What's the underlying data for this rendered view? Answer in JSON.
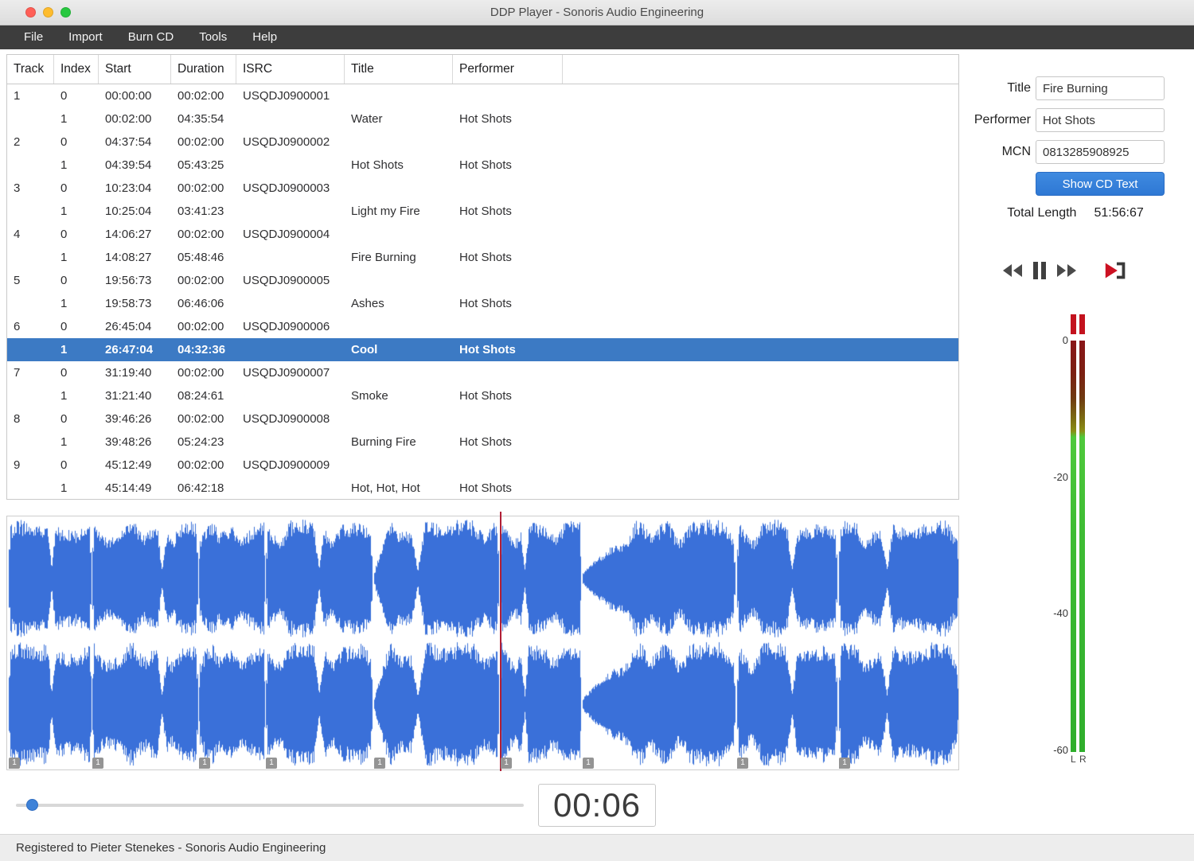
{
  "window": {
    "title": "DDP Player - Sonoris Audio Engineering"
  },
  "menu": {
    "items": [
      "File",
      "Import",
      "Burn CD",
      "Tools",
      "Help"
    ]
  },
  "table": {
    "columns": [
      "Track",
      "Index",
      "Start",
      "Duration",
      "ISRC",
      "Title",
      "Performer"
    ],
    "rows": [
      {
        "track": "1",
        "index": "0",
        "start": "00:00:00",
        "duration": "00:02:00",
        "isrc": "USQDJ0900001",
        "title": "",
        "performer": "",
        "selected": false
      },
      {
        "track": "",
        "index": "1",
        "start": "00:02:00",
        "duration": "04:35:54",
        "isrc": "",
        "title": "Water",
        "performer": "Hot Shots",
        "selected": false
      },
      {
        "track": "2",
        "index": "0",
        "start": "04:37:54",
        "duration": "00:02:00",
        "isrc": "USQDJ0900002",
        "title": "",
        "performer": "",
        "selected": false
      },
      {
        "track": "",
        "index": "1",
        "start": "04:39:54",
        "duration": "05:43:25",
        "isrc": "",
        "title": "Hot Shots",
        "performer": "Hot Shots",
        "selected": false
      },
      {
        "track": "3",
        "index": "0",
        "start": "10:23:04",
        "duration": "00:02:00",
        "isrc": "USQDJ0900003",
        "title": "",
        "performer": "",
        "selected": false
      },
      {
        "track": "",
        "index": "1",
        "start": "10:25:04",
        "duration": "03:41:23",
        "isrc": "",
        "title": "Light my Fire",
        "performer": "Hot Shots",
        "selected": false
      },
      {
        "track": "4",
        "index": "0",
        "start": "14:06:27",
        "duration": "00:02:00",
        "isrc": "USQDJ0900004",
        "title": "",
        "performer": "",
        "selected": false
      },
      {
        "track": "",
        "index": "1",
        "start": "14:08:27",
        "duration": "05:48:46",
        "isrc": "",
        "title": "Fire Burning",
        "performer": "Hot Shots",
        "selected": false
      },
      {
        "track": "5",
        "index": "0",
        "start": "19:56:73",
        "duration": "00:02:00",
        "isrc": "USQDJ0900005",
        "title": "",
        "performer": "",
        "selected": false
      },
      {
        "track": "",
        "index": "1",
        "start": "19:58:73",
        "duration": "06:46:06",
        "isrc": "",
        "title": "Ashes",
        "performer": "Hot Shots",
        "selected": false
      },
      {
        "track": "6",
        "index": "0",
        "start": "26:45:04",
        "duration": "00:02:00",
        "isrc": "USQDJ0900006",
        "title": "",
        "performer": "",
        "selected": false
      },
      {
        "track": "",
        "index": "1",
        "start": "26:47:04",
        "duration": "04:32:36",
        "isrc": "",
        "title": "Cool",
        "performer": "Hot Shots",
        "selected": true
      },
      {
        "track": "7",
        "index": "0",
        "start": "31:19:40",
        "duration": "00:02:00",
        "isrc": "USQDJ0900007",
        "title": "",
        "performer": "",
        "selected": false
      },
      {
        "track": "",
        "index": "1",
        "start": "31:21:40",
        "duration": "08:24:61",
        "isrc": "",
        "title": "Smoke",
        "performer": "Hot Shots",
        "selected": false
      },
      {
        "track": "8",
        "index": "0",
        "start": "39:46:26",
        "duration": "00:02:00",
        "isrc": "USQDJ0900008",
        "title": "",
        "performer": "",
        "selected": false
      },
      {
        "track": "",
        "index": "1",
        "start": "39:48:26",
        "duration": "05:24:23",
        "isrc": "",
        "title": "Burning Fire",
        "performer": "Hot Shots",
        "selected": false
      },
      {
        "track": "9",
        "index": "0",
        "start": "45:12:49",
        "duration": "00:02:00",
        "isrc": "USQDJ0900009",
        "title": "",
        "performer": "",
        "selected": false
      },
      {
        "track": "",
        "index": "1",
        "start": "45:14:49",
        "duration": "06:42:18",
        "isrc": "",
        "title": "Hot, Hot, Hot",
        "performer": "Hot Shots",
        "selected": false
      }
    ]
  },
  "details": {
    "title_label": "Title",
    "title_value": "Fire Burning",
    "performer_label": "Performer",
    "performer_value": "Hot Shots",
    "mcn_label": "MCN",
    "mcn_value": "0813285908925",
    "show_cd_text_label": "Show CD Text",
    "total_length_label": "Total Length",
    "total_length_value": "51:56:67"
  },
  "transport": {
    "icons": [
      "rewind-icon",
      "pause-icon",
      "fast-forward-icon",
      "play-to-marker-icon"
    ]
  },
  "meter": {
    "scale": [
      "0",
      "-20",
      "-40",
      "-60"
    ],
    "channels": [
      "L",
      "R"
    ],
    "colors": {
      "peak": "#c3121e",
      "green": "#3fbd34",
      "accent_blue": "#3a70d9"
    }
  },
  "waveform": {
    "markers": [
      "1",
      "1",
      "1",
      "1",
      "1",
      "1",
      "1",
      "1",
      "1"
    ]
  },
  "player": {
    "time": "00:06"
  },
  "status": {
    "text": "Registered to Pieter Stenekes - Sonoris Audio Engineering"
  }
}
